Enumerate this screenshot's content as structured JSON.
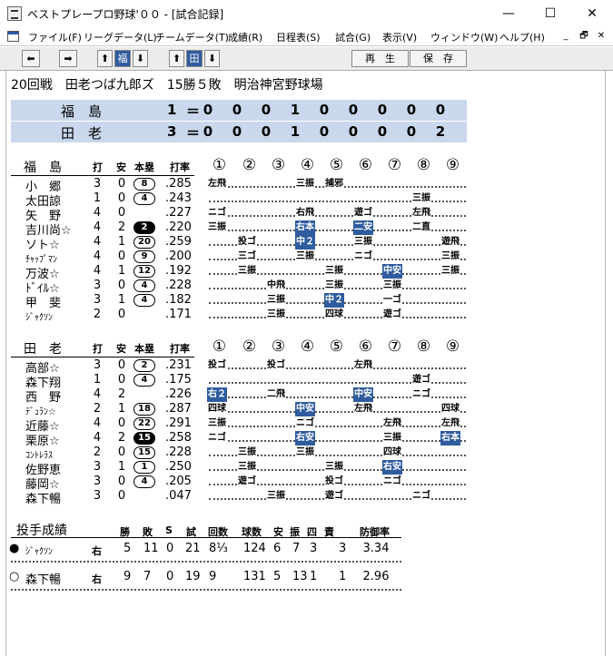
{
  "window": {
    "title": "ベストプレープロ野球'００ - [試合記録]",
    "minimize": "—",
    "maximize": "☐",
    "close": "✕"
  },
  "menu": [
    "ファイル(F)",
    "リーグデータ(L)",
    "チームデータ(T)",
    "成績(R)",
    "日程表(S)",
    "試合(G)",
    "表示(V)",
    "ウィンドウ(W)",
    "ヘルプ(H)"
  ],
  "mdi": {
    "minimize": "_",
    "restore": "🗗",
    "close": "✕"
  },
  "toolbar": {
    "prev": "⬅",
    "next": "➡",
    "up1": "⬆",
    "team1": "福",
    "down1": "⬇",
    "up2": "⬆",
    "team2": "田",
    "down2": "⬇",
    "play": "再　生",
    "save": "保　存"
  },
  "game_info": "20回戦　田老つば九郎ズ　15勝５敗　明治神宮野球場",
  "scoreboard": [
    {
      "team": "福　島",
      "total": "1",
      "eq": "＝",
      "innings": [
        "0",
        "0",
        "0",
        "1",
        "0",
        "0",
        "0",
        "0",
        "0"
      ]
    },
    {
      "team": "田　老",
      "total": "3",
      "eq": "＝",
      "innings": [
        "0",
        "0",
        "0",
        "1",
        "0",
        "0",
        "0",
        "0",
        "2"
      ]
    }
  ],
  "columns": {
    "ab": "打",
    "hits": "安",
    "hr": "本塁",
    "avg": "打率",
    "innings": [
      "①",
      "②",
      "③",
      "④",
      "⑤",
      "⑥",
      "⑦",
      "⑧",
      "⑨"
    ]
  },
  "team1": {
    "name": "福　島",
    "players": [
      {
        "name": "小　郷",
        "ab": "3",
        "h": "0",
        "hr": "8",
        "hr_filled": false,
        "avg": ".285",
        "small": false,
        "results": [
          {
            "inn": 1,
            "text": "左飛"
          },
          {
            "inn": 4,
            "text": "三振"
          },
          {
            "inn": 5,
            "text": "捕邪"
          }
        ]
      },
      {
        "name": "太田諒",
        "ab": "1",
        "h": "0",
        "hr": "4",
        "hr_filled": false,
        "avg": ".243",
        "small": false,
        "results": [
          {
            "inn": 8,
            "text": "三振"
          }
        ]
      },
      {
        "name": "矢　野",
        "ab": "4",
        "h": "0",
        "hr": "",
        "hr_filled": false,
        "avg": ".227",
        "small": false,
        "results": [
          {
            "inn": 1,
            "text": "ニゴ"
          },
          {
            "inn": 4,
            "text": "右飛"
          },
          {
            "inn": 6,
            "text": "遊ゴ"
          },
          {
            "inn": 8,
            "text": "左飛"
          }
        ]
      },
      {
        "name": "吉川尚☆",
        "ab": "4",
        "h": "2",
        "hr": "2",
        "hr_filled": true,
        "avg": ".220",
        "small": false,
        "results": [
          {
            "inn": 1,
            "text": "三振"
          },
          {
            "inn": 4,
            "text": "右本",
            "hl": true
          },
          {
            "inn": 6,
            "text": "二安",
            "hl": true
          },
          {
            "inn": 8,
            "text": "二直"
          }
        ]
      },
      {
        "name": "ソト☆",
        "ab": "4",
        "h": "1",
        "hr": "20",
        "hr_filled": false,
        "avg": ".259",
        "small": false,
        "results": [
          {
            "inn": 2,
            "text": "投ゴ"
          },
          {
            "inn": 4,
            "text": "中２",
            "hl": true
          },
          {
            "inn": 6,
            "text": "三振"
          },
          {
            "inn": 9,
            "text": "遊飛"
          }
        ]
      },
      {
        "name": "ﾁｬｯﾌﾟﾏﾝ",
        "ab": "4",
        "h": "0",
        "hr": "9",
        "hr_filled": false,
        "avg": ".200",
        "small": true,
        "results": [
          {
            "inn": 2,
            "text": "三ゴ"
          },
          {
            "inn": 4,
            "text": "三振"
          },
          {
            "inn": 6,
            "text": "ニゴ"
          },
          {
            "inn": 9,
            "text": "三振"
          }
        ]
      },
      {
        "name": "万波☆",
        "ab": "4",
        "h": "1",
        "hr": "12",
        "hr_filled": false,
        "avg": ".192",
        "small": false,
        "results": [
          {
            "inn": 2,
            "text": "三振"
          },
          {
            "inn": 5,
            "text": "三振"
          },
          {
            "inn": 7,
            "text": "中安",
            "hl": true
          },
          {
            "inn": 9,
            "text": "三振"
          }
        ]
      },
      {
        "name": "ﾄﾞｲﾙ☆",
        "ab": "3",
        "h": "0",
        "hr": "4",
        "hr_filled": false,
        "avg": ".228",
        "small": false,
        "results": [
          {
            "inn": 3,
            "text": "中飛"
          },
          {
            "inn": 5,
            "text": "三振"
          },
          {
            "inn": 7,
            "text": "三振"
          }
        ]
      },
      {
        "name": "甲　斐",
        "ab": "3",
        "h": "1",
        "hr": "4",
        "hr_filled": false,
        "avg": ".182",
        "small": false,
        "results": [
          {
            "inn": 3,
            "text": "三振"
          },
          {
            "inn": 5,
            "text": "中２",
            "hl": true
          },
          {
            "inn": 7,
            "text": "一ゴ"
          }
        ]
      },
      {
        "name": "ｼﾞｬｸｿﾝ",
        "ab": "2",
        "h": "0",
        "hr": "",
        "hr_filled": false,
        "avg": ".171",
        "small": true,
        "results": [
          {
            "inn": 3,
            "text": "三振"
          },
          {
            "inn": 5,
            "text": "四球"
          },
          {
            "inn": 7,
            "text": "遊ゴ"
          }
        ]
      }
    ]
  },
  "team2": {
    "name": "田　老",
    "players": [
      {
        "name": "高部☆",
        "ab": "3",
        "h": "0",
        "hr": "2",
        "hr_filled": false,
        "avg": ".231",
        "small": false,
        "results": [
          {
            "inn": 1,
            "text": "投ゴ"
          },
          {
            "inn": 3,
            "text": "投ゴ"
          },
          {
            "inn": 6,
            "text": "左飛"
          }
        ]
      },
      {
        "name": "森下翔",
        "ab": "1",
        "h": "0",
        "hr": "4",
        "hr_filled": false,
        "avg": ".175",
        "small": false,
        "results": [
          {
            "inn": 8,
            "text": "遊ゴ"
          }
        ]
      },
      {
        "name": "西　野",
        "ab": "4",
        "h": "2",
        "hr": "",
        "hr_filled": false,
        "avg": ".226",
        "small": false,
        "results": [
          {
            "inn": 1,
            "text": "右２",
            "hl": true
          },
          {
            "inn": 3,
            "text": "二飛"
          },
          {
            "inn": 6,
            "text": "中安",
            "hl": true
          },
          {
            "inn": 8,
            "text": "ニゴ"
          }
        ]
      },
      {
        "name": "ﾃﾞｭﾗﾝ☆",
        "ab": "2",
        "h": "1",
        "hr": "18",
        "hr_filled": false,
        "avg": ".287",
        "small": true,
        "results": [
          {
            "inn": 1,
            "text": "四球"
          },
          {
            "inn": 4,
            "text": "中安",
            "hl": true
          },
          {
            "inn": 6,
            "text": "左飛"
          },
          {
            "inn": 9,
            "text": "四球"
          }
        ]
      },
      {
        "name": "近藤☆",
        "ab": "4",
        "h": "0",
        "hr": "22",
        "hr_filled": false,
        "avg": ".291",
        "small": false,
        "results": [
          {
            "inn": 1,
            "text": "三振"
          },
          {
            "inn": 4,
            "text": "ニゴ"
          },
          {
            "inn": 7,
            "text": "左飛"
          },
          {
            "inn": 9,
            "text": "左飛"
          }
        ]
      },
      {
        "name": "栗原☆",
        "ab": "4",
        "h": "2",
        "hr": "15",
        "hr_filled": true,
        "avg": ".258",
        "small": false,
        "results": [
          {
            "inn": 1,
            "text": "ニゴ"
          },
          {
            "inn": 4,
            "text": "右安",
            "hl": true
          },
          {
            "inn": 7,
            "text": "三振"
          },
          {
            "inn": 9,
            "text": "右本",
            "hl": true
          }
        ]
      },
      {
        "name": "ｺﾝﾄﾚﾗｽ",
        "ab": "2",
        "h": "0",
        "hr": "15",
        "hr_filled": false,
        "avg": ".228",
        "small": true,
        "results": [
          {
            "inn": 2,
            "text": "三振"
          },
          {
            "inn": 4,
            "text": "三振"
          },
          {
            "inn": 7,
            "text": "四球"
          }
        ]
      },
      {
        "name": "佐野恵",
        "ab": "3",
        "h": "1",
        "hr": "1",
        "hr_filled": false,
        "avg": ".250",
        "small": false,
        "results": [
          {
            "inn": 2,
            "text": "三振"
          },
          {
            "inn": 5,
            "text": "三振"
          },
          {
            "inn": 7,
            "text": "右安",
            "hl": true
          }
        ]
      },
      {
        "name": "藤岡☆",
        "ab": "3",
        "h": "0",
        "hr": "4",
        "hr_filled": false,
        "avg": ".205",
        "small": false,
        "results": [
          {
            "inn": 2,
            "text": "遊ゴ"
          },
          {
            "inn": 5,
            "text": "投ゴ"
          },
          {
            "inn": 7,
            "text": "ニゴ"
          }
        ]
      },
      {
        "name": "森下暢",
        "ab": "3",
        "h": "0",
        "hr": "",
        "hr_filled": false,
        "avg": ".047",
        "small": false,
        "results": [
          {
            "inn": 3,
            "text": "三振"
          },
          {
            "inn": 5,
            "text": "遊ゴ"
          },
          {
            "inn": 8,
            "text": "ニゴ"
          }
        ]
      }
    ]
  },
  "pitching": {
    "title": "投手成績",
    "headers": [
      "勝",
      "敗",
      "S",
      "試",
      "回数",
      "球数",
      "安",
      "振",
      "四",
      "責",
      "防御率"
    ],
    "rows": [
      {
        "mark": "●",
        "name": "ｼﾞｬｸｿﾝ",
        "hand": "右",
        "w": "5",
        "l": "11",
        "s": "0",
        "g": "21",
        "ip": "8⅓",
        "pitches": "124",
        "h": "6",
        "k": "7",
        "bb": "3",
        "er": "3",
        "era": "3.34"
      },
      {
        "mark": "○",
        "name": "森下暢",
        "hand": "右",
        "w": "9",
        "l": "7",
        "s": "0",
        "g": "19",
        "ip": "9",
        "pitches": "131",
        "h": "5",
        "k": "13",
        "bb": "1",
        "er": "1",
        "era": "2.96"
      }
    ]
  }
}
